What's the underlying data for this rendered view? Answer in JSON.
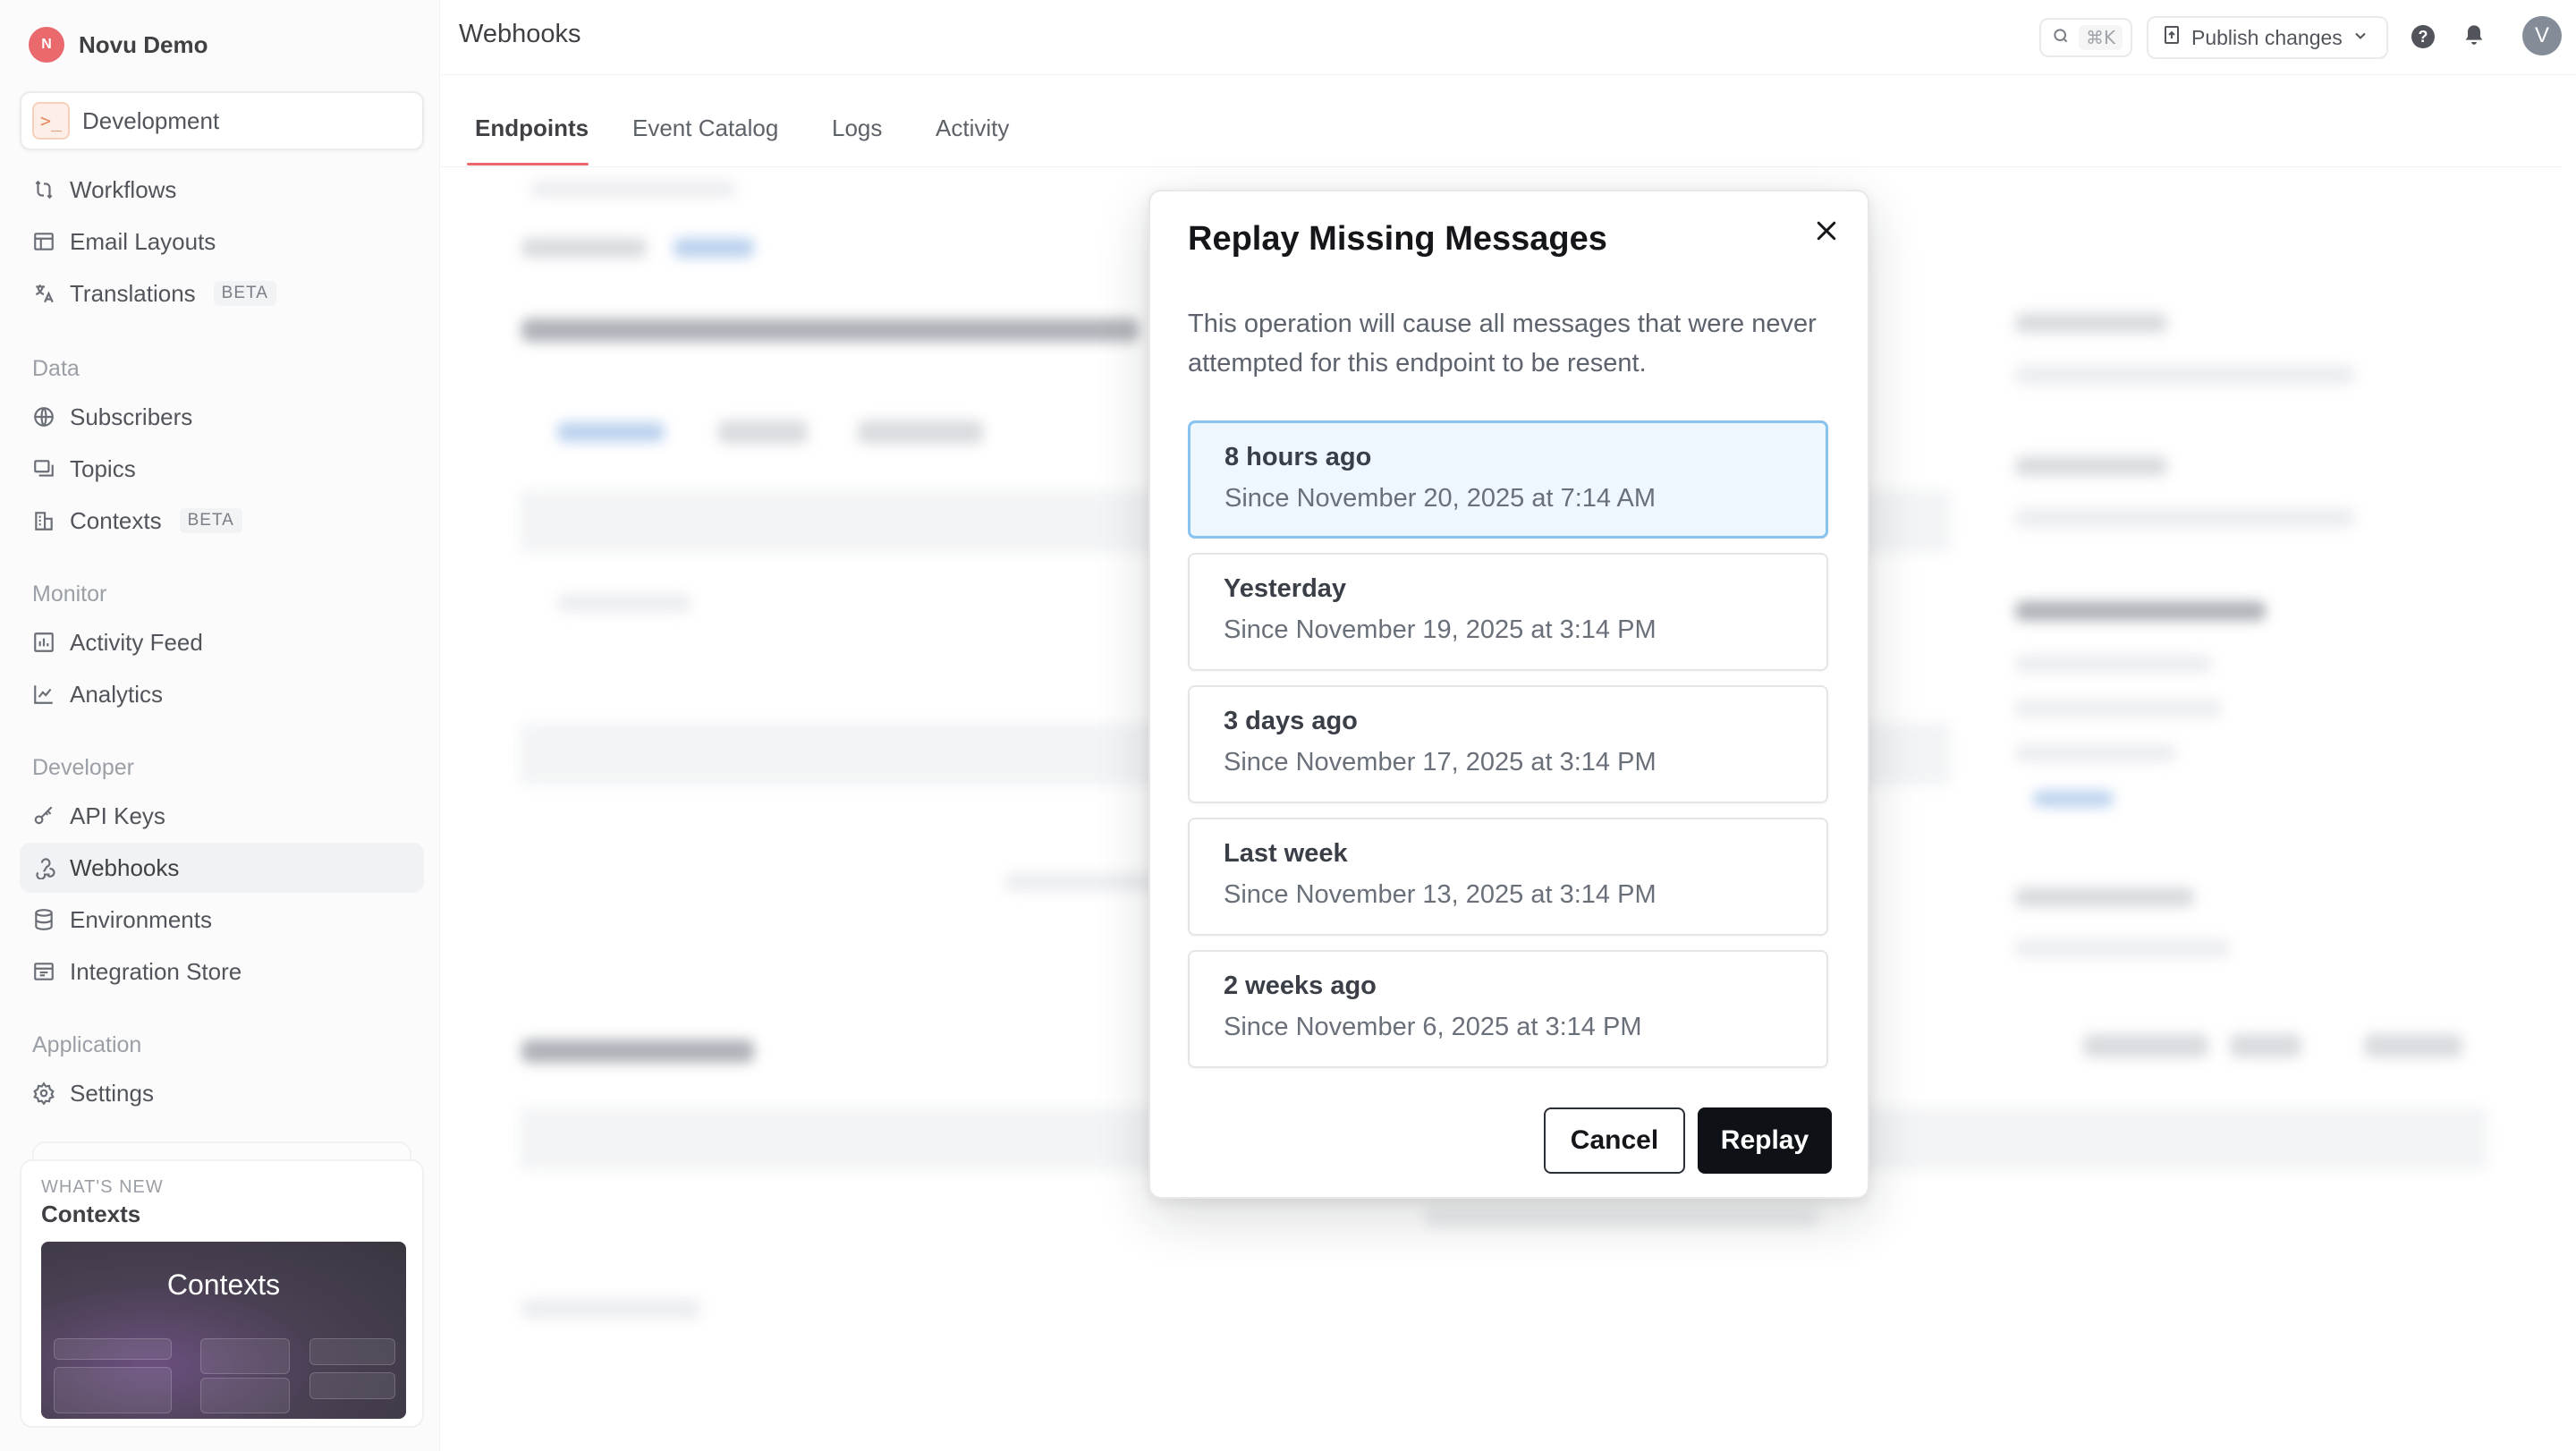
{
  "org": {
    "initial": "N",
    "name": "Novu Demo"
  },
  "environment": {
    "icon_glyph": ">_",
    "label": "Development"
  },
  "nav": {
    "workflows": "Workflows",
    "email_layouts": "Email Layouts",
    "translations": "Translations",
    "translations_badge": "BETA",
    "data_section": "Data",
    "subscribers": "Subscribers",
    "topics": "Topics",
    "contexts": "Contexts",
    "contexts_badge": "BETA",
    "monitor_section": "Monitor",
    "activity_feed": "Activity Feed",
    "analytics": "Analytics",
    "developer_section": "Developer",
    "api_keys": "API Keys",
    "webhooks": "Webhooks",
    "environments": "Environments",
    "integration_store": "Integration Store",
    "application_section": "Application",
    "settings": "Settings"
  },
  "whats_new": {
    "kicker": "WHAT'S NEW",
    "title": "Contexts",
    "image_title": "Contexts"
  },
  "header": {
    "title": "Webhooks",
    "search_shortcut": "⌘K",
    "publish_label": "Publish changes",
    "help_glyph": "?",
    "user_initial": "V"
  },
  "tabs": [
    "Endpoints",
    "Event Catalog",
    "Logs",
    "Activity"
  ],
  "modal": {
    "title": "Replay Missing Messages",
    "description": "This operation will cause all messages that were never attempted for this endpoint to be resent.",
    "options": [
      {
        "title": "8 hours ago",
        "subtitle": "Since November 20, 2025 at 7:14 AM",
        "selected": true
      },
      {
        "title": "Yesterday",
        "subtitle": "Since November 19, 2025 at 3:14 PM",
        "selected": false
      },
      {
        "title": "3 days ago",
        "subtitle": "Since November 17, 2025 at 3:14 PM",
        "selected": false
      },
      {
        "title": "Last week",
        "subtitle": "Since November 13, 2025 at 3:14 PM",
        "selected": false
      },
      {
        "title": "2 weeks ago",
        "subtitle": "Since November 6, 2025 at 3:14 PM",
        "selected": false
      }
    ],
    "cancel_label": "Cancel",
    "replay_label": "Replay"
  },
  "colors": {
    "accent": "#e5484d",
    "selected_bg": "#eef7fe",
    "selected_border": "#88c2ee",
    "primary_button": "#0e1116"
  }
}
